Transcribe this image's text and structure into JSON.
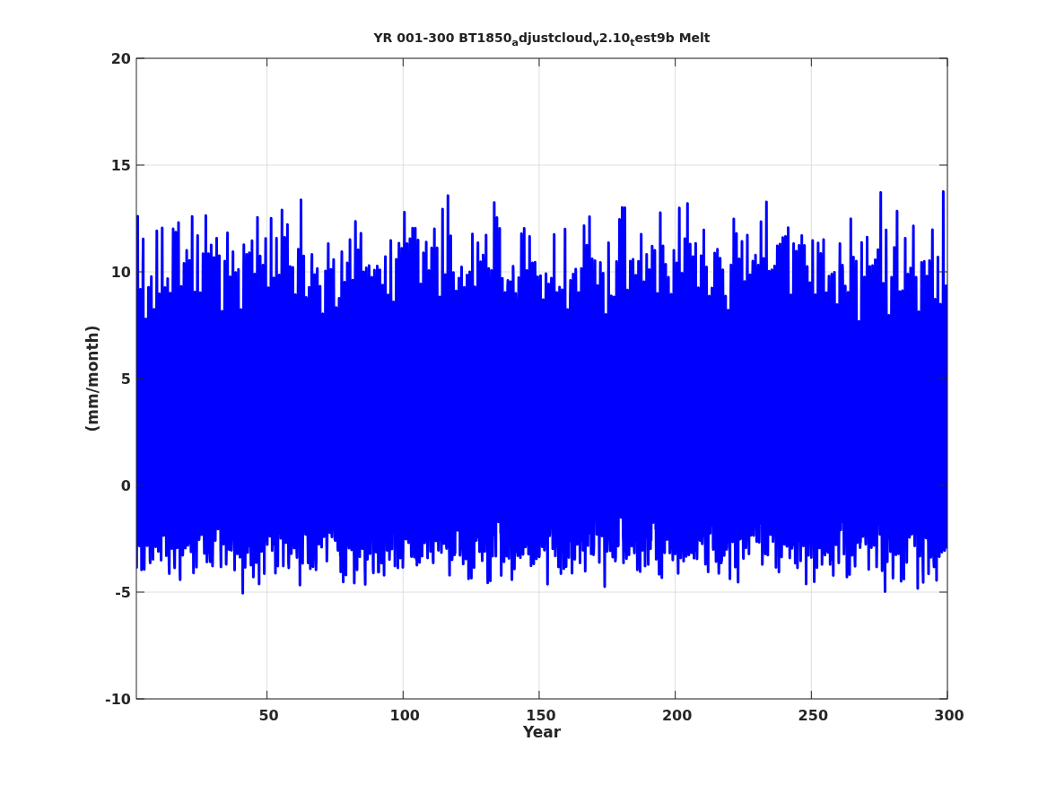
{
  "chart": {
    "title": "YR 001-300 BT1850$_{a}$djustcloud$_{v}$2.10$_{t}$est9b Melt",
    "xlabel": "Year",
    "ylabel": "(mm/month)",
    "xticks": [
      "50",
      "100",
      "150",
      "200",
      "250",
      "300"
    ],
    "yticks": [
      "20",
      "15",
      "10",
      "5",
      "0",
      "-5",
      "-10"
    ]
  }
}
